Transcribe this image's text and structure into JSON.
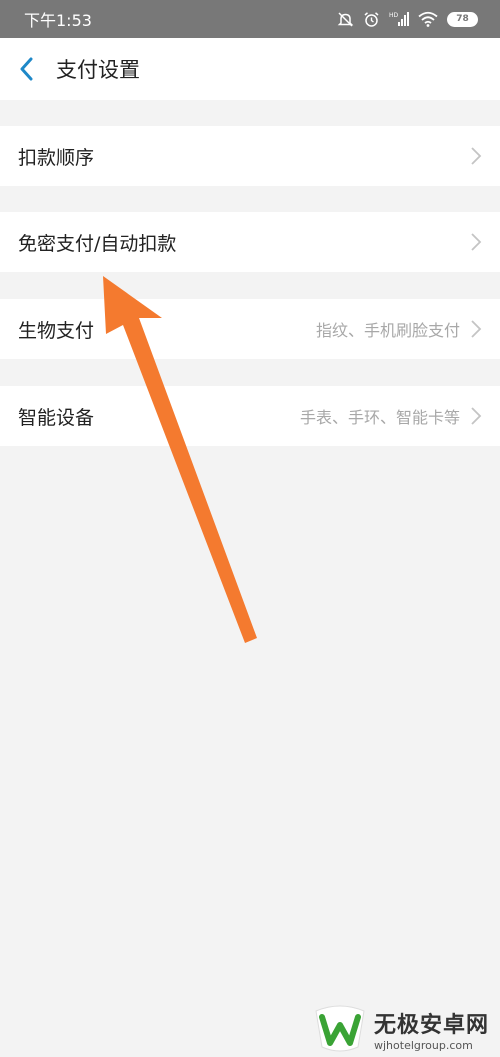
{
  "status_bar": {
    "time": "下午1:53",
    "battery": "78"
  },
  "nav": {
    "title": "支付设置"
  },
  "settings": {
    "items": [
      {
        "label": "扣款顺序",
        "value": ""
      },
      {
        "label": "免密支付/自动扣款",
        "value": ""
      },
      {
        "label": "生物支付",
        "value": "指纹、手机刷脸支付"
      },
      {
        "label": "智能设备",
        "value": "手表、手环、智能卡等"
      }
    ]
  },
  "watermark": {
    "title": "无极安卓网",
    "url": "wjhotelgroup.com"
  },
  "colors": {
    "status_bar_bg": "#787878",
    "page_bg": "#f3f3f3",
    "back_arrow": "#1e88c8",
    "annotation_arrow": "#f47a2f",
    "logo_green": "#3aa335"
  }
}
